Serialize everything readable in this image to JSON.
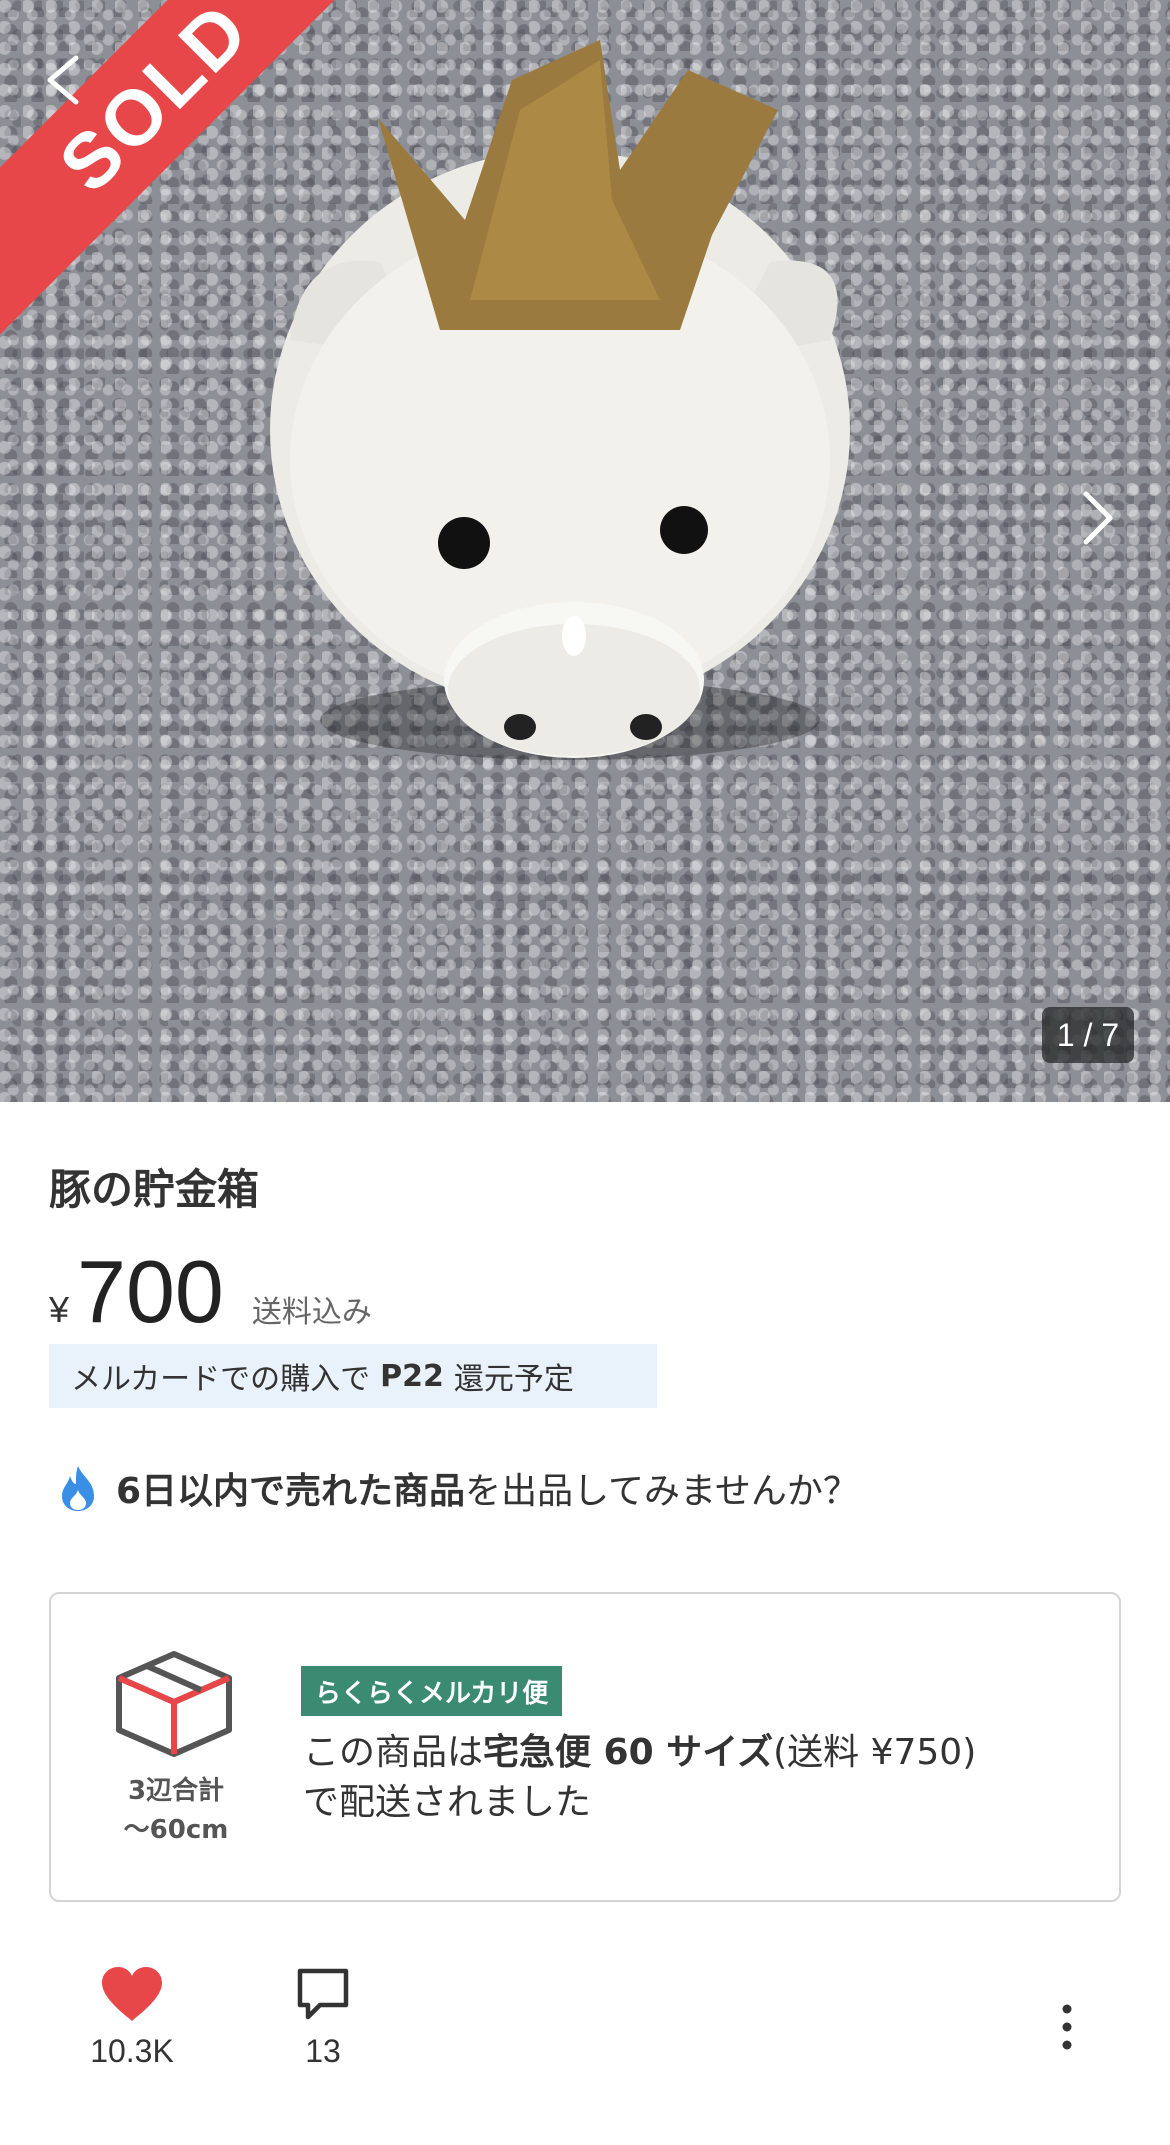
{
  "photo": {
    "sold_label": "SOLD",
    "counter": "1 / 7",
    "back_icon": "chevron-left-icon",
    "next_icon": "chevron-right-icon",
    "sold_color": "#e8474a"
  },
  "item": {
    "title": "豚の貯金箱",
    "currency": "¥",
    "price": "700",
    "shipping_note": "送料込み"
  },
  "points": {
    "prefix": "メルカードでの購入で",
    "amount": "P22",
    "suffix": "還元予定"
  },
  "promo": {
    "icon": "flame-icon",
    "bold": "6日以内で売れた商品",
    "rest": "を出品してみませんか？"
  },
  "shipping": {
    "box_icon": "box-icon",
    "size_line1": "3辺合計",
    "size_line2": "～60cm",
    "badge": "らくらくメルカリ便",
    "text_pre": "この商品は",
    "text_bold": "宅急便 60 サイズ",
    "text_mid": "(送料 ¥750)",
    "text_post": "で配送されました",
    "badge_color": "#3b8a72"
  },
  "actions": {
    "like_icon": "heart-icon",
    "like_count": "10.3K",
    "comment_icon": "comment-icon",
    "comment_count": "13",
    "more_icon": "more-vertical-icon",
    "like_color": "#e8474a"
  }
}
